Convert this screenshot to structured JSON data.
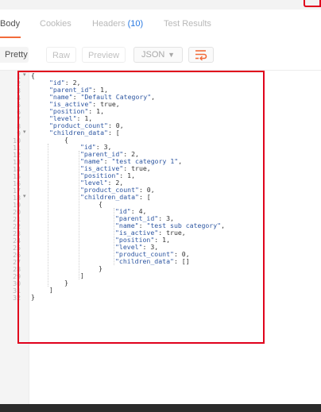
{
  "tabs": {
    "body": "Body",
    "cookies": "Cookies",
    "headers": "Headers",
    "headers_count": "(10)",
    "test_results": "Test Results"
  },
  "view": {
    "pretty": "Pretty",
    "raw": "Raw",
    "preview": "Preview",
    "format": "JSON",
    "wrap_icon": "wrap-lines-icon"
  },
  "line_numbers": [
    "1",
    "2",
    "3",
    "4",
    "5",
    "6",
    "7",
    "8",
    "9",
    "10",
    "11",
    "12",
    "13",
    "14",
    "15",
    "16",
    "17",
    "18",
    "19",
    "20",
    "21",
    "22",
    "23",
    "24",
    "25",
    "26",
    "27",
    "28",
    "29",
    "30",
    "31",
    "32"
  ],
  "code_lines": [
    "{",
    "\"id\": 2,",
    "\"parent_id\": 1,",
    "\"name\": \"Default Category\",",
    "\"is_active\": true,",
    "\"position\": 1,",
    "\"level\": 1,",
    "\"product_count\": 0,",
    "\"children_data\": [",
    "{",
    "\"id\": 3,",
    "\"parent_id\": 2,",
    "\"name\": \"test category 1\",",
    "\"is_active\": true,",
    "\"position\": 1,",
    "\"level\": 2,",
    "\"product_count\": 0,",
    "\"children_data\": [",
    "{",
    "\"id\": 4,",
    "\"parent_id\": 3,",
    "\"name\": \"test sub category\",",
    "\"is_active\": true,",
    "\"position\": 1,",
    "\"level\": 3,",
    "\"product_count\": 0,",
    "\"children_data\": []",
    "}",
    "]",
    "}",
    "]",
    "}"
  ],
  "colors": {
    "highlight": "#e0001c",
    "tab_accent": "#f26b3a",
    "link_blue": "#2a7ae2",
    "code_key": "#2d56a1"
  }
}
